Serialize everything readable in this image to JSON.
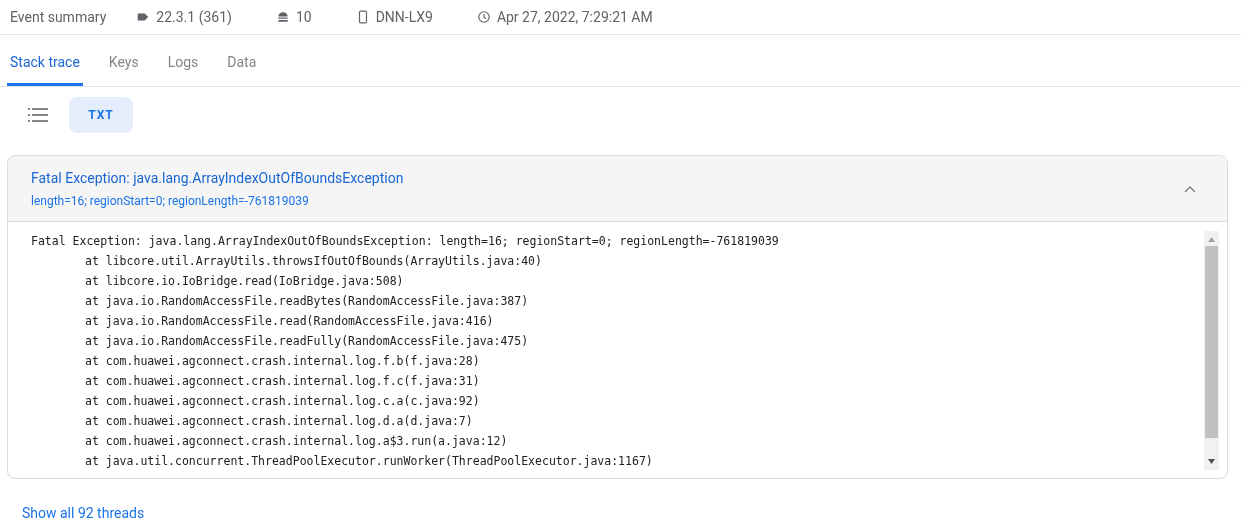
{
  "summary": {
    "title": "Event summary",
    "items": [
      {
        "kind": "tag",
        "text": "22.3.1 (361)"
      },
      {
        "kind": "android",
        "text": "10"
      },
      {
        "kind": "phone",
        "text": "DNN-LX9"
      },
      {
        "kind": "clock",
        "text": "Apr 27, 2022, 7:29:21 AM"
      }
    ]
  },
  "tabs": [
    {
      "label": "Stack trace",
      "selected": true
    },
    {
      "label": "Keys",
      "selected": false
    },
    {
      "label": "Logs",
      "selected": false
    },
    {
      "label": "Data",
      "selected": false
    }
  ],
  "view_toggle": [
    {
      "kind": "list",
      "selected": false
    },
    {
      "kind": "text",
      "label": "TXT",
      "selected": true
    }
  ],
  "exception": {
    "title": "Fatal Exception: java.lang.ArrayIndexOutOfBoundsException",
    "message": "length=16; regionStart=0; regionLength=-761819039",
    "expanded": true,
    "lines": [
      {
        "kind": "head",
        "text": "Fatal Exception: java.lang.ArrayIndexOutOfBoundsException: length=16; regionStart=0; regionLength=-761819039"
      },
      {
        "kind": "frame",
        "text": "at libcore.util.ArrayUtils.throwsIfOutOfBounds(ArrayUtils.java:40)"
      },
      {
        "kind": "frame",
        "text": "at libcore.io.IoBridge.read(IoBridge.java:508)"
      },
      {
        "kind": "frame",
        "text": "at java.io.RandomAccessFile.readBytes(RandomAccessFile.java:387)"
      },
      {
        "kind": "frame",
        "text": "at java.io.RandomAccessFile.read(RandomAccessFile.java:416)"
      },
      {
        "kind": "frame",
        "text": "at java.io.RandomAccessFile.readFully(RandomAccessFile.java:475)"
      },
      {
        "kind": "frame",
        "text": "at com.huawei.agconnect.crash.internal.log.f.b(f.java:28)"
      },
      {
        "kind": "frame",
        "text": "at com.huawei.agconnect.crash.internal.log.f.c(f.java:31)"
      },
      {
        "kind": "frame",
        "text": "at com.huawei.agconnect.crash.internal.log.c.a(c.java:92)"
      },
      {
        "kind": "frame",
        "text": "at com.huawei.agconnect.crash.internal.log.d.a(d.java:7)"
      },
      {
        "kind": "frame",
        "text": "at com.huawei.agconnect.crash.internal.log.a$3.run(a.java:12)"
      },
      {
        "kind": "frame",
        "text": "at java.util.concurrent.ThreadPoolExecutor.runWorker(ThreadPoolExecutor.java:1167)"
      }
    ]
  },
  "footer_link": "Show all 92 threads"
}
